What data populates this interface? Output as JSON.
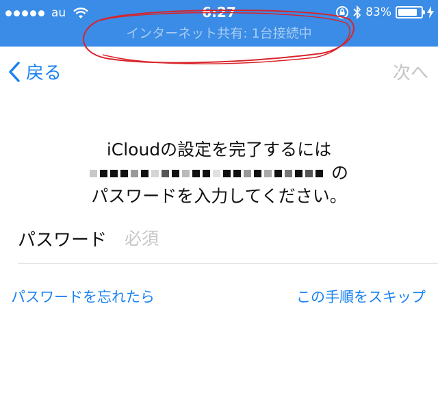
{
  "status_bar": {
    "carrier": "au",
    "time": "6:27",
    "battery": "83%",
    "battery_level": 0.83,
    "hotspot_banner": "インターネット共有: 1台接続中"
  },
  "nav": {
    "back_label": "戻る",
    "next_label": "次へ"
  },
  "message": {
    "line1": "iCloudの設定を完了するには",
    "line2_suffix": "の",
    "line3": "パスワードを入力してください。"
  },
  "form": {
    "password_label": "パスワード",
    "password_placeholder": "必須",
    "password_value": ""
  },
  "links": {
    "forgot_password": "パスワードを忘れたら",
    "skip_step": "この手順をスキップ"
  },
  "colors": {
    "status_bar_bg": "#3a8ce6",
    "accent": "#1a82f0",
    "disabled": "#c4c4c4",
    "annotation": "#d9232a"
  },
  "icons": {
    "back": "chevron-left-icon",
    "wifi": "wifi-icon",
    "lock_rotation": "orientation-lock-icon",
    "bluetooth": "bluetooth-icon",
    "battery": "battery-icon",
    "charging": "charging-bolt-icon"
  }
}
